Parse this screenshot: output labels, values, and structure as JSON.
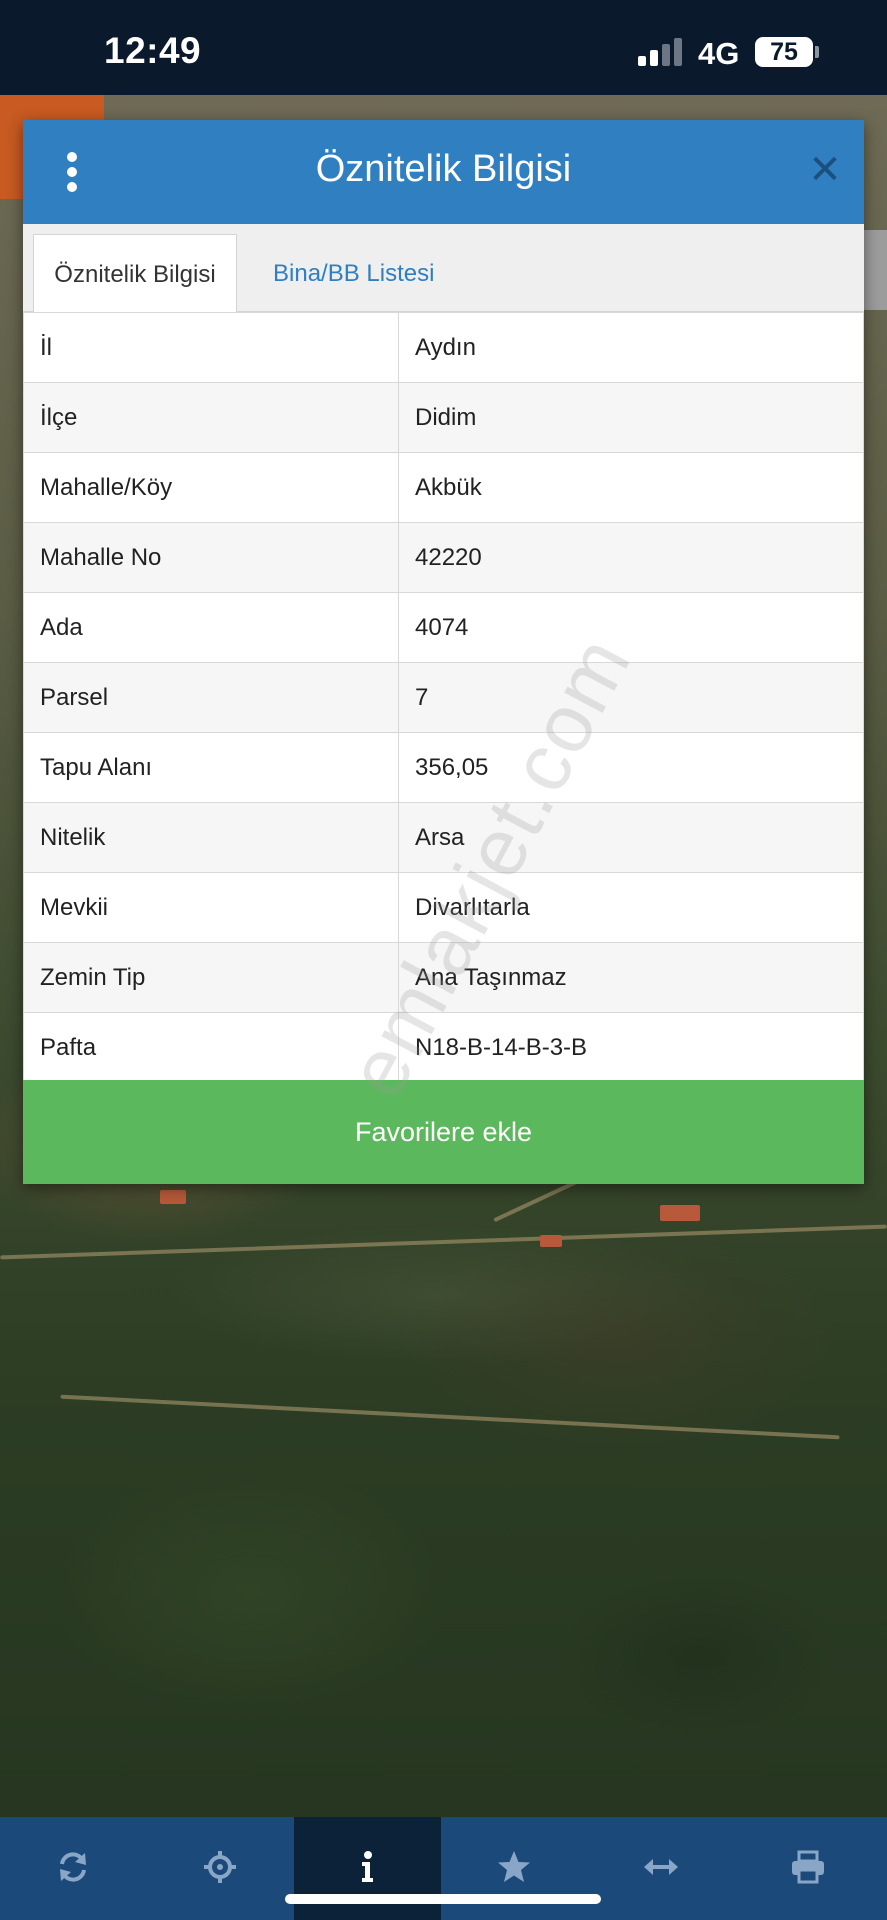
{
  "status_bar": {
    "time": "12:49",
    "network": "4G",
    "battery": "75",
    "signal_bars_active": 2,
    "signal_bars_total": 4
  },
  "dialog": {
    "title": "Öznitelik Bilgisi",
    "menu_icon": "vertical-dots-icon",
    "close_icon": "close-icon",
    "tabs": [
      {
        "label": "Öznitelik Bilgisi",
        "active": true
      },
      {
        "label": "Bina/BB Listesi",
        "active": false
      }
    ],
    "rows": [
      {
        "key": "İl",
        "value": "Aydın"
      },
      {
        "key": "İlçe",
        "value": "Didim"
      },
      {
        "key": "Mahalle/Köy",
        "value": "Akbük"
      },
      {
        "key": "Mahalle No",
        "value": "42220"
      },
      {
        "key": "Ada",
        "value": "4074"
      },
      {
        "key": "Parsel",
        "value": "7"
      },
      {
        "key": "Tapu Alanı",
        "value": "356,05"
      },
      {
        "key": "Nitelik",
        "value": "Arsa"
      },
      {
        "key": "Mevkii",
        "value": "Divarlıtarla"
      },
      {
        "key": "Zemin Tip",
        "value": "Ana Taşınmaz"
      },
      {
        "key": "Pafta",
        "value": "N18-B-14-B-3-B"
      }
    ],
    "favorite_button": "Favorilere ekle"
  },
  "watermark": "emlakjet.com",
  "toolbar": {
    "items": [
      {
        "name": "refresh-icon",
        "active": false
      },
      {
        "name": "locate-icon",
        "active": false
      },
      {
        "name": "info-icon",
        "active": true
      },
      {
        "name": "star-icon",
        "active": false
      },
      {
        "name": "measure-icon",
        "active": false
      },
      {
        "name": "print-icon",
        "active": false
      }
    ]
  },
  "colors": {
    "header_blue": "#2f7fc1",
    "button_green": "#5cb85c",
    "toolbar_blue": "#1b4a7a",
    "status_bar": "#0a1a2c"
  }
}
